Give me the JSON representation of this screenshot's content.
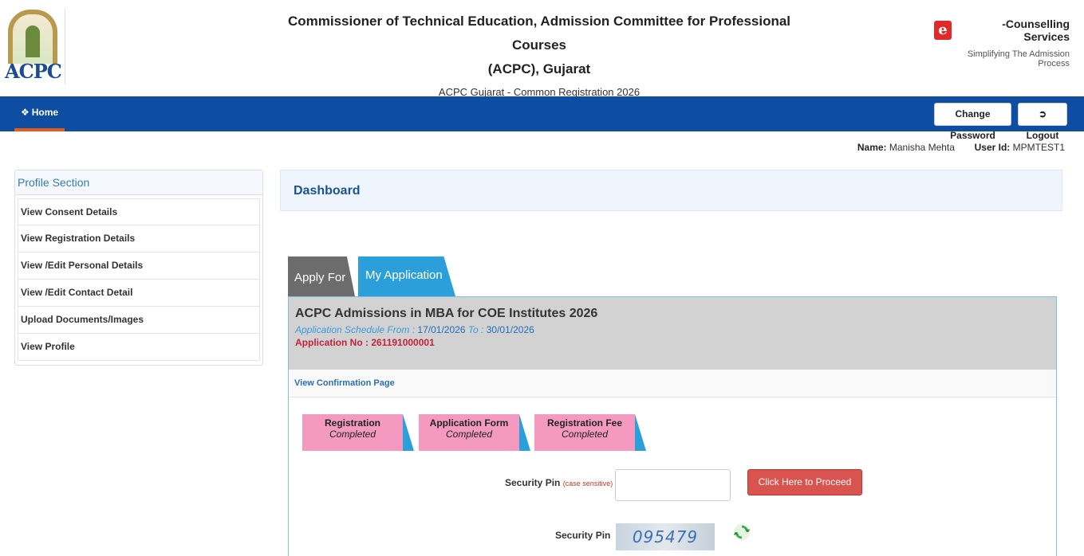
{
  "header": {
    "logo_text": "ACPC",
    "title_line1": "Commissioner of Technical Education, Admission Committee for Professional Courses",
    "title_line2": "(ACPC), Gujarat",
    "subtitle": "ACPC Gujarat - Common Registration 2026",
    "ec_icon_letter": "e",
    "ec_title": "-Counselling Services",
    "ec_tagline": "Simplifying The Admission Process"
  },
  "nav": {
    "home_label": "Home",
    "change_password_label": "Change Password",
    "logout_label": "Logout"
  },
  "user": {
    "name_label": "Name:",
    "name": "Manisha Mehta",
    "id_label": "User Id:",
    "id": "MPMTEST1"
  },
  "sidebar": {
    "title": "Profile Section",
    "items": [
      {
        "label": "View Consent Details"
      },
      {
        "label": "View Registration Details"
      },
      {
        "label": "View /Edit Personal Details"
      },
      {
        "label": "View /Edit Contact Detail"
      },
      {
        "label": "Upload Documents/Images"
      },
      {
        "label": "View Profile"
      }
    ]
  },
  "main": {
    "title": "Dashboard",
    "tabs": [
      {
        "label": "Apply For"
      },
      {
        "label": "My Application"
      }
    ],
    "application": {
      "title": "ACPC Admissions in MBA for COE Institutes 2026",
      "schedule_from_label": "Application Schedule From : ",
      "schedule_from": "17/01/2026",
      "schedule_to_label": " To : ",
      "schedule_to": "30/01/2026",
      "app_no_label": "Application No : ",
      "app_no": "261191000001",
      "confirmation_link": "View Confirmation Page"
    },
    "steps": [
      {
        "name": "Registration",
        "status": "Completed"
      },
      {
        "name": "Application Form",
        "status": "Completed"
      },
      {
        "name": "Registration Fee",
        "status": "Completed"
      }
    ],
    "security": {
      "pin_label": "Security Pin",
      "pin_hint": "(case sensitive)",
      "pin_value": "",
      "proceed_label": "Click Here to Proceed",
      "captcha_label": "Security Pin",
      "captcha_value": "095479"
    }
  },
  "colors": {
    "nav_bg": "#0d4ea3",
    "nav_accent": "#e65c1f",
    "tab_active": "#2b9fda",
    "tab_inactive": "#6c6c6c",
    "step_bg": "#f49ac1",
    "proceed_btn": "#d9534f",
    "app_no": "#c0243d"
  }
}
